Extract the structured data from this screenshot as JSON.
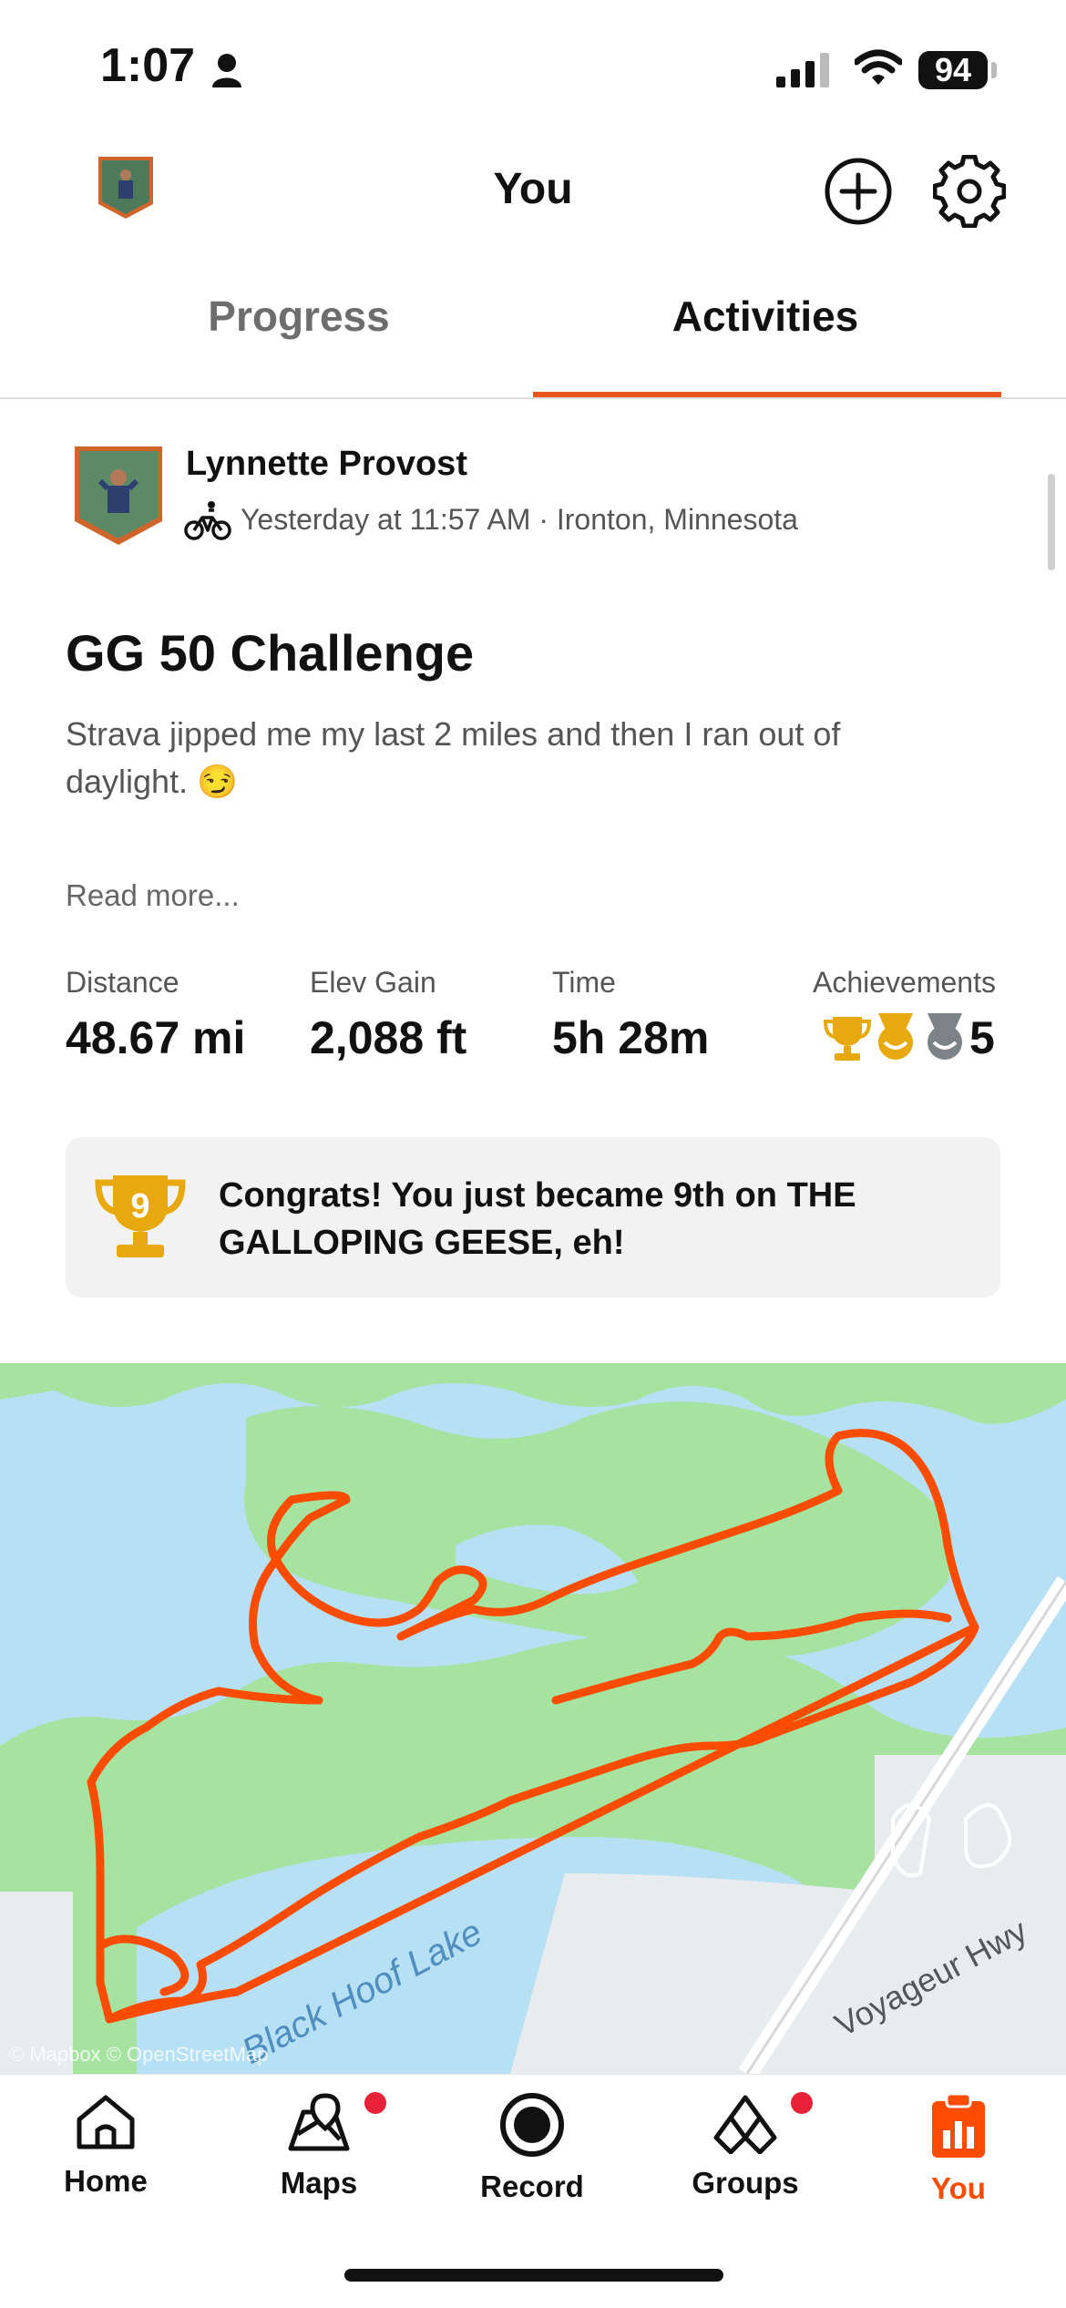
{
  "status_bar": {
    "time": "1:07",
    "battery": "94"
  },
  "header": {
    "title": "You"
  },
  "tabs": [
    {
      "label": "Progress"
    },
    {
      "label": "Activities"
    }
  ],
  "activity": {
    "athlete": "Lynnette Provost",
    "meta": "Yesterday at 11:57 AM · Ironton, Minnesota",
    "title": "GG 50 Challenge",
    "description": "Strava jipped me my last 2 miles and then I ran out of daylight. 😏",
    "read_more": "Read more...",
    "stats": [
      {
        "label": "Distance",
        "value": "48.67 mi"
      },
      {
        "label": "Elev Gain",
        "value": "2,088 ft"
      },
      {
        "label": "Time",
        "value": "5h 28m"
      },
      {
        "label": "Achievements",
        "value": "5"
      }
    ],
    "congrats": "Congrats! You just became 9th on THE GALLOPING GEESE, eh!",
    "trophy_rank": "9"
  },
  "map": {
    "labels": {
      "lake": "Black Hoof Lake",
      "road": "Voyageur Hwy"
    },
    "attribution": "© Mapbox © OpenStreetMap"
  },
  "nav": [
    {
      "label": "Home",
      "icon": "home-icon"
    },
    {
      "label": "Maps",
      "icon": "maps-icon"
    },
    {
      "label": "Record",
      "icon": "record-icon"
    },
    {
      "label": "Groups",
      "icon": "groups-icon"
    },
    {
      "label": "You",
      "icon": "you-icon"
    }
  ],
  "colors": {
    "accent": "#e8561f",
    "gold": "#e8a90f",
    "silver": "#7b8386",
    "water": "#b7e0f5",
    "land": "#a6e3a1",
    "notification": "#e8213a"
  }
}
